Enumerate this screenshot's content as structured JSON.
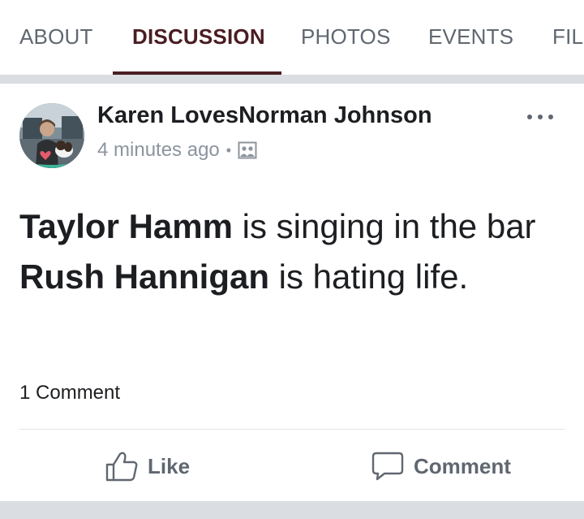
{
  "tabs": [
    {
      "label": "ABOUT",
      "active": false
    },
    {
      "label": "DISCUSSION",
      "active": true
    },
    {
      "label": "PHOTOS",
      "active": false
    },
    {
      "label": "EVENTS",
      "active": false
    },
    {
      "label": "FIL",
      "active": false
    }
  ],
  "post": {
    "author": "Karen LovesNorman Johnson",
    "timestamp": "4 minutes ago",
    "separator": "•",
    "audience_icon": "group-photo-icon",
    "text": {
      "name1": "Taylor Hamm",
      "part1": " is singing in the bar ",
      "name2": "Rush Hannigan",
      "part2": " is hating life."
    },
    "comment_count": "1 Comment",
    "actions": {
      "like": "Like",
      "comment": "Comment"
    }
  },
  "colors": {
    "accent": "#4a1d22",
    "text_primary": "#1c1e21",
    "text_secondary": "#606770",
    "text_meta": "#8d949e",
    "background": "#dadde1"
  },
  "icons": {
    "more": "more-options-icon",
    "like": "thumbs-up-icon",
    "comment": "speech-bubble-icon"
  }
}
